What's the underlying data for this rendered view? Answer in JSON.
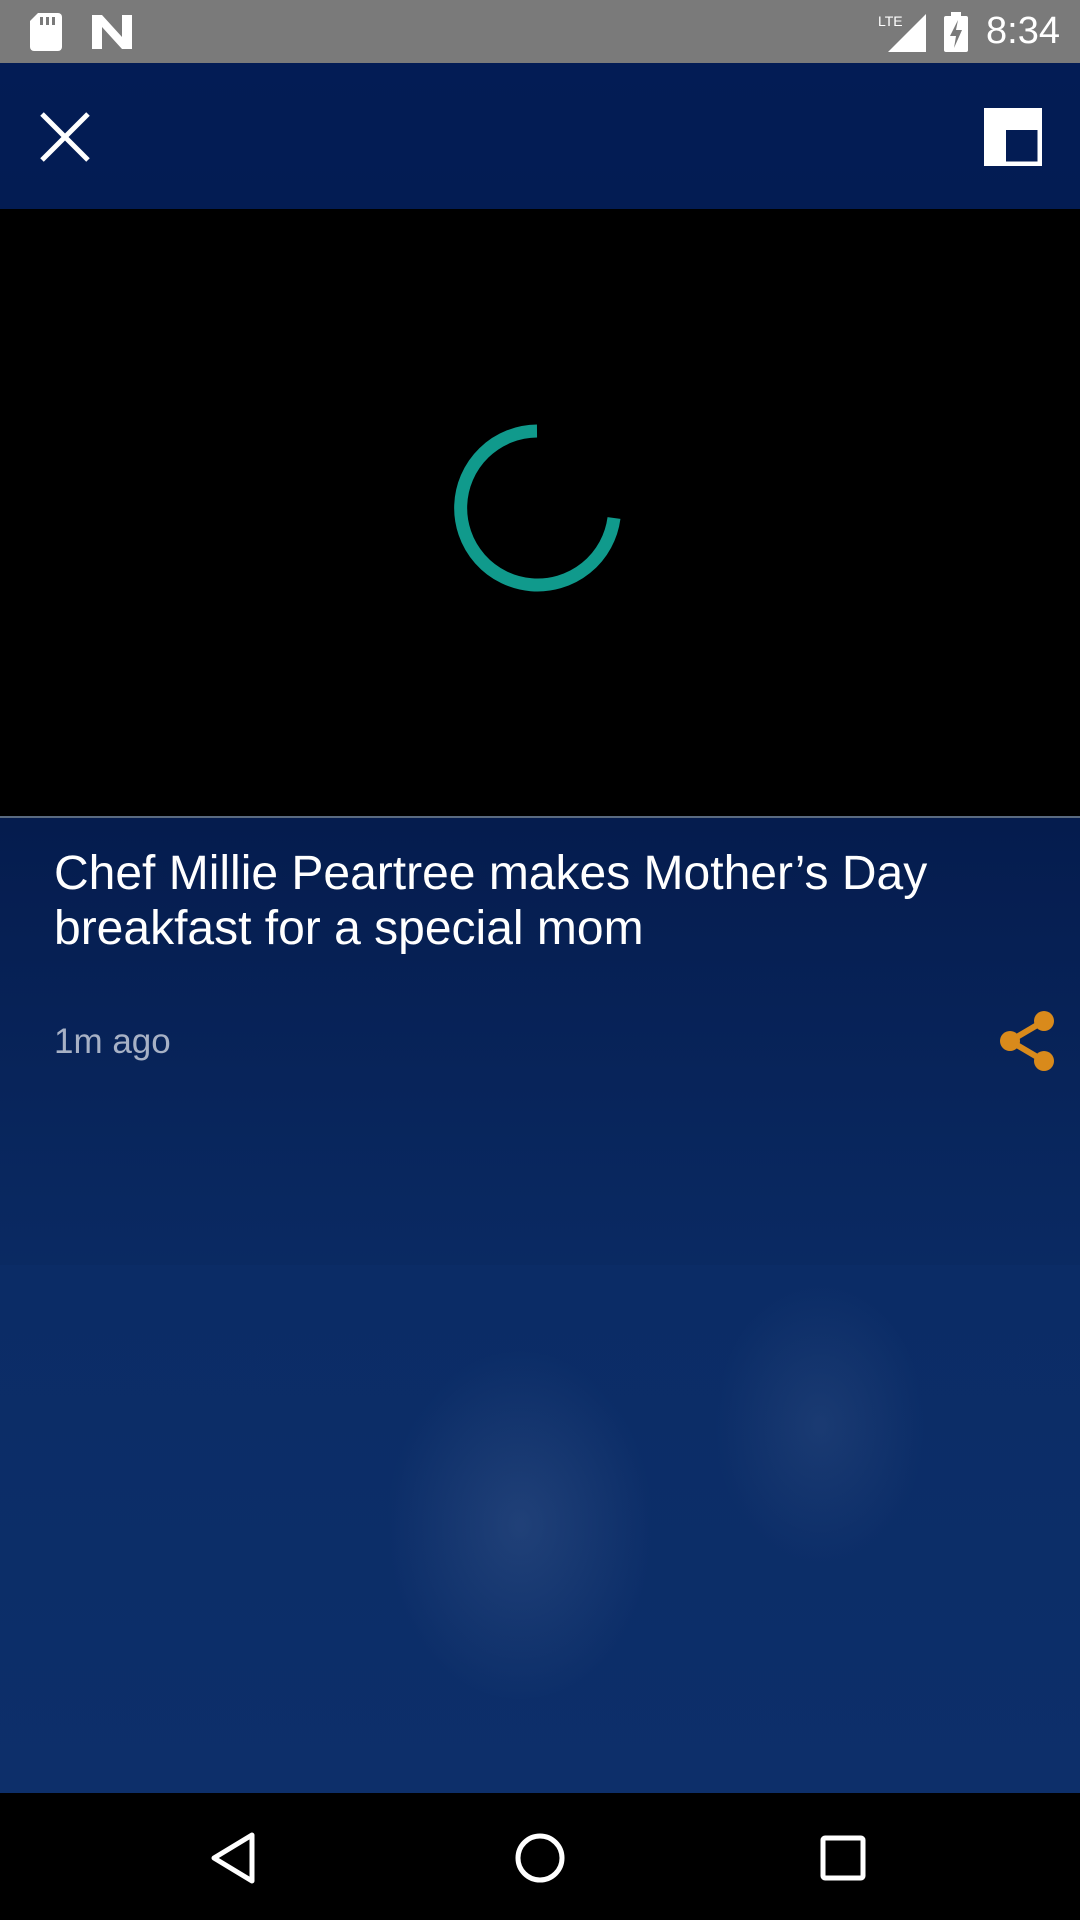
{
  "status_bar": {
    "time": "8:34",
    "network": "LTE",
    "icons": [
      "sd-card-icon",
      "n-notification-icon",
      "lte-signal-icon",
      "battery-charging-icon"
    ]
  },
  "toolbar": {
    "close_icon": "close-icon",
    "pip_icon": "picture-in-picture-icon"
  },
  "video": {
    "loading": true,
    "spinner_color": "#109a8c"
  },
  "article": {
    "title": "Chef Millie Peartree makes Mother’s Day breakfast for a special mom",
    "timestamp": "1m ago",
    "share_icon": "share-icon",
    "share_color": "#d98a1b"
  },
  "nav_bar": {
    "icons": [
      "back-triangle-icon",
      "home-circle-icon",
      "recents-square-icon"
    ]
  },
  "colors": {
    "background": "#041a4a",
    "status_bar": "#7a7a7a",
    "player": "#000000"
  }
}
